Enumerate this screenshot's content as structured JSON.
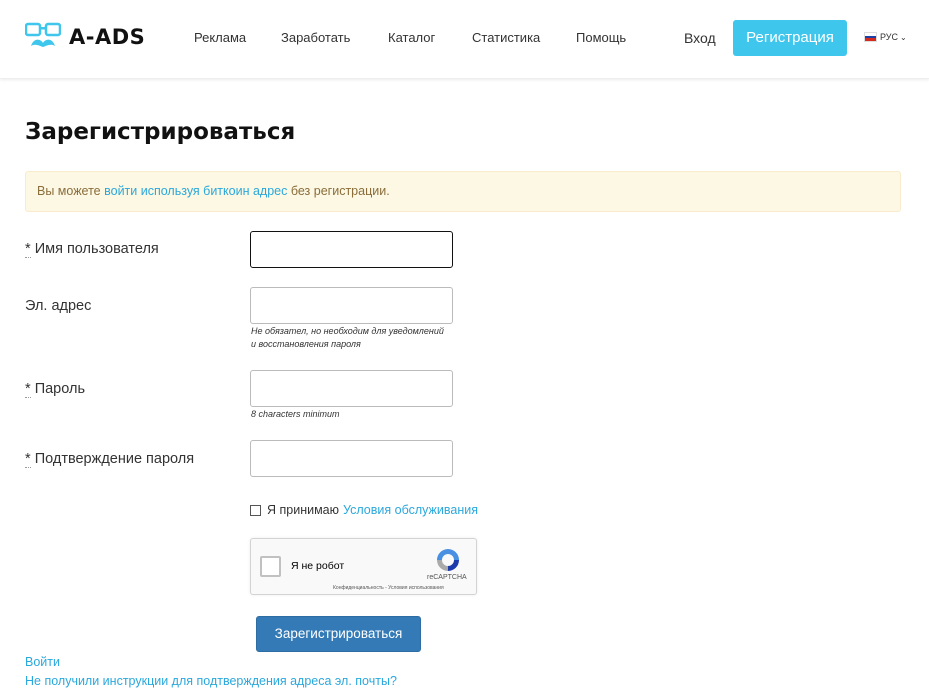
{
  "header": {
    "brand": "A-ADS",
    "nav": [
      "Реклама",
      "Заработать",
      "Каталог",
      "Статистика",
      "Помощь"
    ],
    "login": "Вход",
    "register": "Регистрация",
    "lang": "РУС"
  },
  "page": {
    "title": "Зарегистрироваться",
    "alert_prefix": "Вы можете",
    "alert_link": "войти используя биткоин адрес",
    "alert_suffix": "без регистрации."
  },
  "form": {
    "star": "*",
    "username_label": "Имя пользователя",
    "email_label": "Эл. адрес",
    "email_hint_1": "Не обязател, но необходим для уведомлений",
    "email_hint_2": "и восстановления пароля",
    "password_label": "Пароль",
    "password_hint": "8 characters minimum",
    "confirm_label": "Подтверждение пароля",
    "agree_text": "Я принимаю",
    "terms_link": "Условия обслуживания",
    "submit": "Зарегистрироваться"
  },
  "recaptcha": {
    "label": "Я не робот",
    "brand": "reCAPTCHA",
    "privacy": "Конфиденциальность",
    "sep": "-",
    "terms": "Условия использования"
  },
  "footer_links": {
    "login": "Войти",
    "resend": "Не получили инструкции для подтверждения адреса эл. почты?"
  },
  "colors": {
    "accent": "#3ec6ec",
    "link": "#2aa8dc",
    "primary_button": "#337ab7",
    "alert_bg": "#fcf8e3"
  }
}
